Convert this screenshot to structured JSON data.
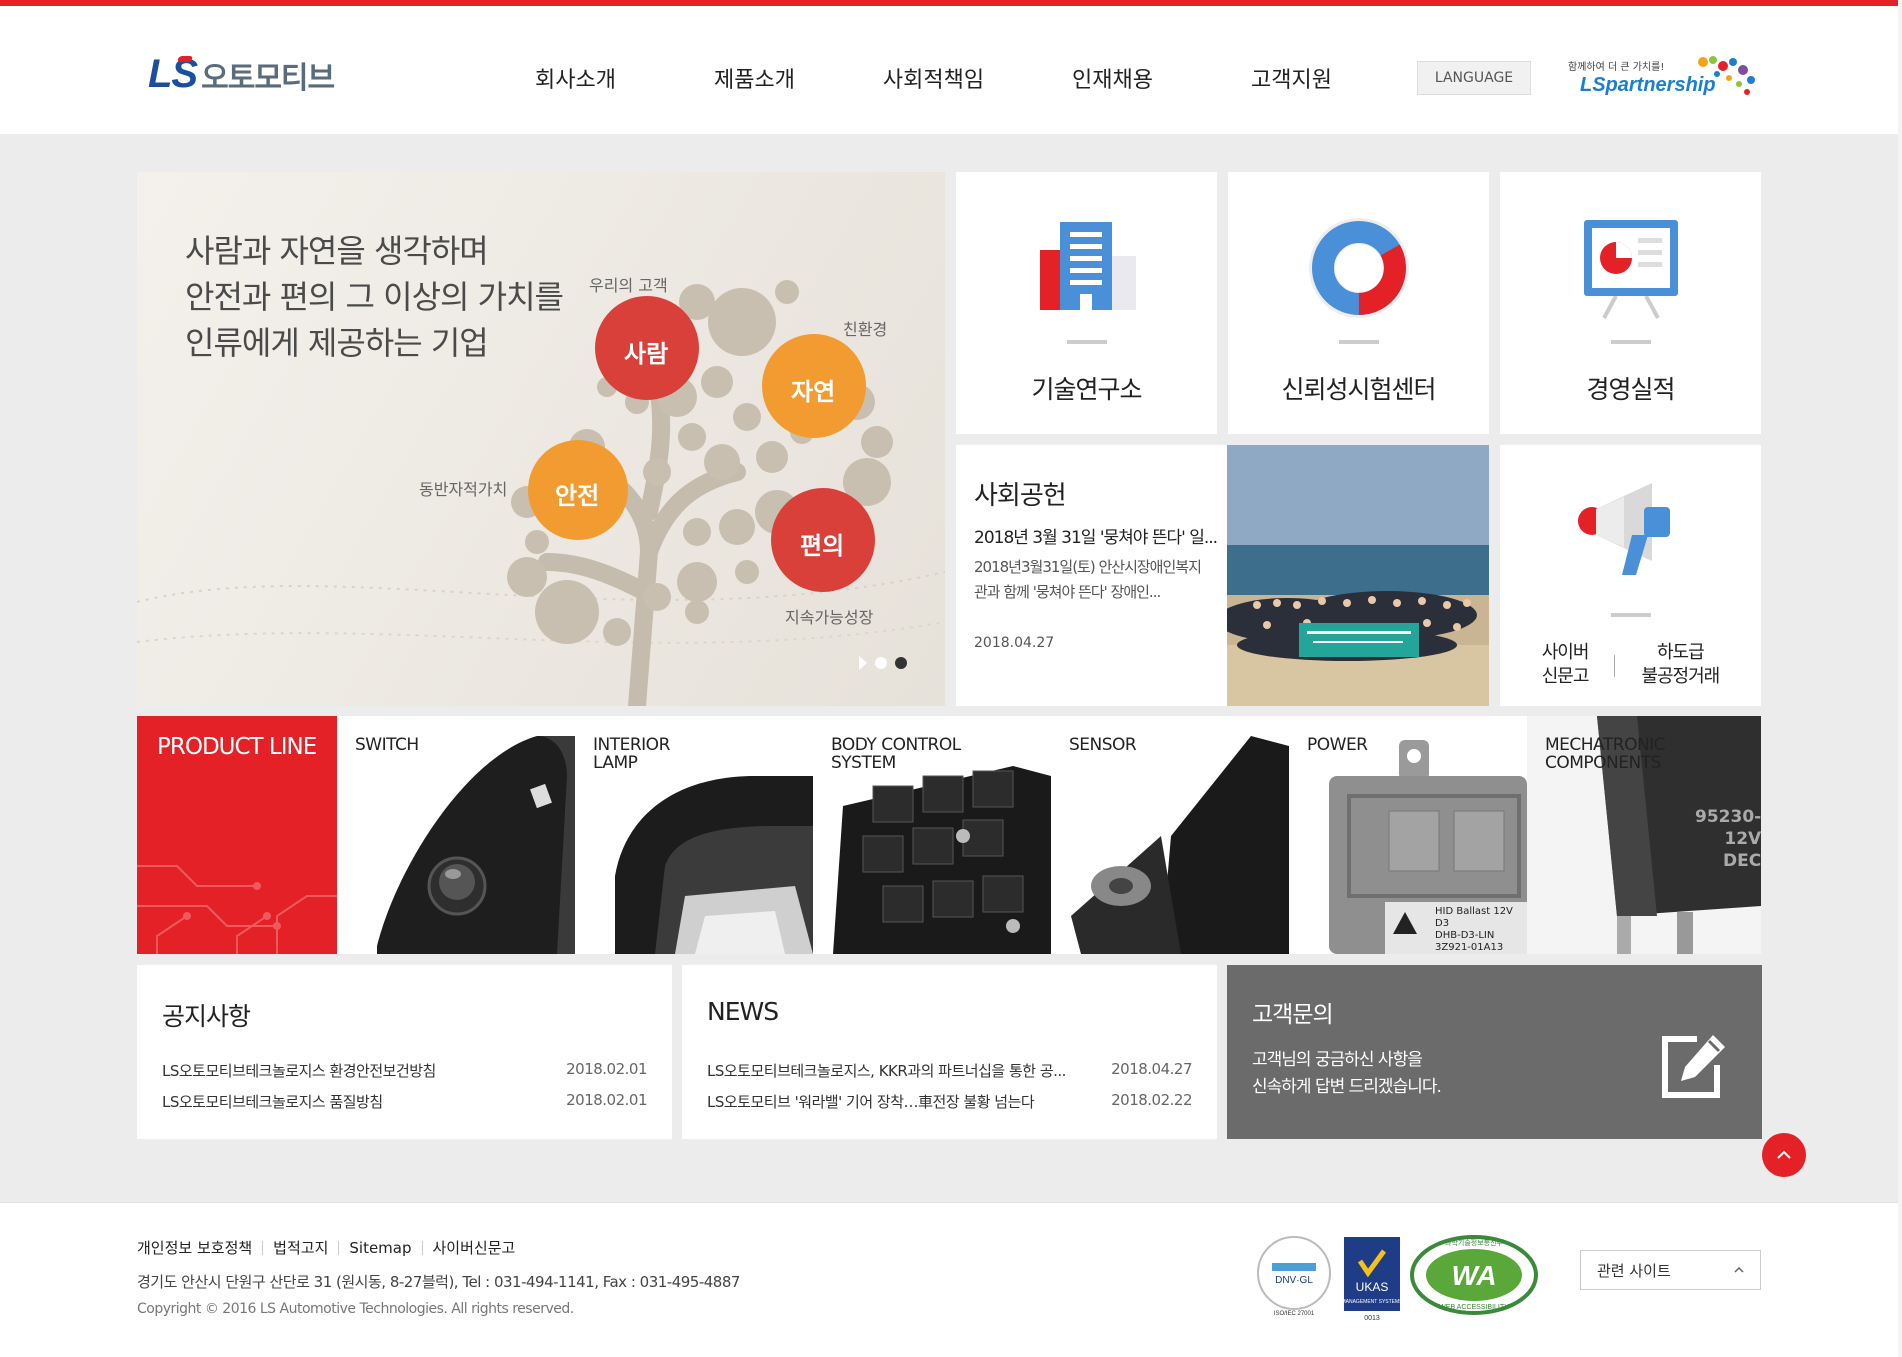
{
  "header": {
    "logo_ls": "LS",
    "logo_text": "오토모티브",
    "nav": [
      "회사소개",
      "제품소개",
      "사회적책임",
      "인재채용",
      "고객지원"
    ],
    "language_label": "LANGUAGE",
    "partner_slogan": "함께하여 더 큰 가치를!",
    "partner_name": "LSpartnership"
  },
  "hero": {
    "lines": [
      "사람과 자연을 생각하며",
      "안전과 편의 그 이상의 가치를",
      "인류에게 제공하는 기업"
    ],
    "circle_labels": [
      "사람",
      "자연",
      "안전",
      "편의"
    ],
    "side_labels": [
      "우리의 고객",
      "친환경",
      "동반자적가치",
      "지속가능성장"
    ],
    "slide_count": 2,
    "active_slide": 2
  },
  "tiles": [
    {
      "label": "기술연구소",
      "icon": "building-icon"
    },
    {
      "label": "신뢰성시험센터",
      "icon": "donut-chart-icon"
    },
    {
      "label": "경영실적",
      "icon": "presentation-board-icon"
    }
  ],
  "social": {
    "title": "사회공헌",
    "headline": "2018년 3월 31일 '뭉쳐야 뜬다' 일...",
    "body_line1": "2018년3월31일(토) 안산시장애인복지",
    "body_line2": "관과 함께 '뭉쳐야 뜬다' 장애인...",
    "date": "2018.04.27"
  },
  "report": {
    "icon": "megaphone-icon",
    "link1_line1": "사이버",
    "link1_line2": "신문고",
    "link2_line1": "하도급",
    "link2_line2": "불공정거래"
  },
  "products": {
    "heading": "PRODUCT LINE",
    "items": [
      "SWITCH",
      "INTERIOR\nLAMP",
      "BODY CONTROL\nSYSTEM",
      "SENSOR",
      "POWER",
      "MECHATRONIC\nCOMPONENTS"
    ],
    "power_label_lines": [
      "HID Ballast 12V D3",
      "DHB-D3-LIN",
      "3Z921-01A13"
    ],
    "relay_label_lines": [
      "95230-",
      "12V",
      "DEC"
    ]
  },
  "notice": {
    "title": "공지사항",
    "items": [
      {
        "title": "LS오토모티브테크놀로지스 환경안전보건방침",
        "date": "2018.02.01"
      },
      {
        "title": "LS오토모티브테크놀로지스 품질방침",
        "date": "2018.02.01"
      }
    ]
  },
  "news": {
    "title": "NEWS",
    "items": [
      {
        "title": "LS오토모티브테크놀로지스, KKR과의 파트너십을 통한 공...",
        "date": "2018.04.27"
      },
      {
        "title": "LS오토모티브 '워라밸' 기어 장착…車전장 불황 넘는다",
        "date": "2018.02.22"
      }
    ]
  },
  "contact": {
    "title": "고객문의",
    "line1": "고객님의 궁금하신 사항을",
    "line2": "신속하게 답변 드리겠습니다."
  },
  "footer": {
    "links": [
      "개인정보 보호정책",
      "법적고지",
      "Sitemap",
      "사이버신문고"
    ],
    "address": "경기도 안산시 단원구 산단로 31 (원시동, 8-27블럭),    Tel : 031-494-1141,    Fax : 031-495-4887",
    "copyright": "Copyright © 2016 LS Automotive Technologies. All rights reserved.",
    "related_label": "관련 사이트",
    "cert_dnv": "DNV·GL",
    "cert_dnv_code": "ISO/IEC 27001",
    "cert_ukas": "UKAS",
    "cert_ukas_sub": "MANAGEMENT SYSTEMS",
    "cert_ukas_code": "0013",
    "cert_wa": "WA",
    "cert_wa_top": "과학기술정보통신부",
    "cert_wa_bottom": "WEB ACCESSIBILITY"
  },
  "colors": {
    "brand_red": "#e42127",
    "brand_blue": "#1a4f9c",
    "tile_blue": "#4a90d9",
    "contact_gray": "#6b6b6b"
  }
}
